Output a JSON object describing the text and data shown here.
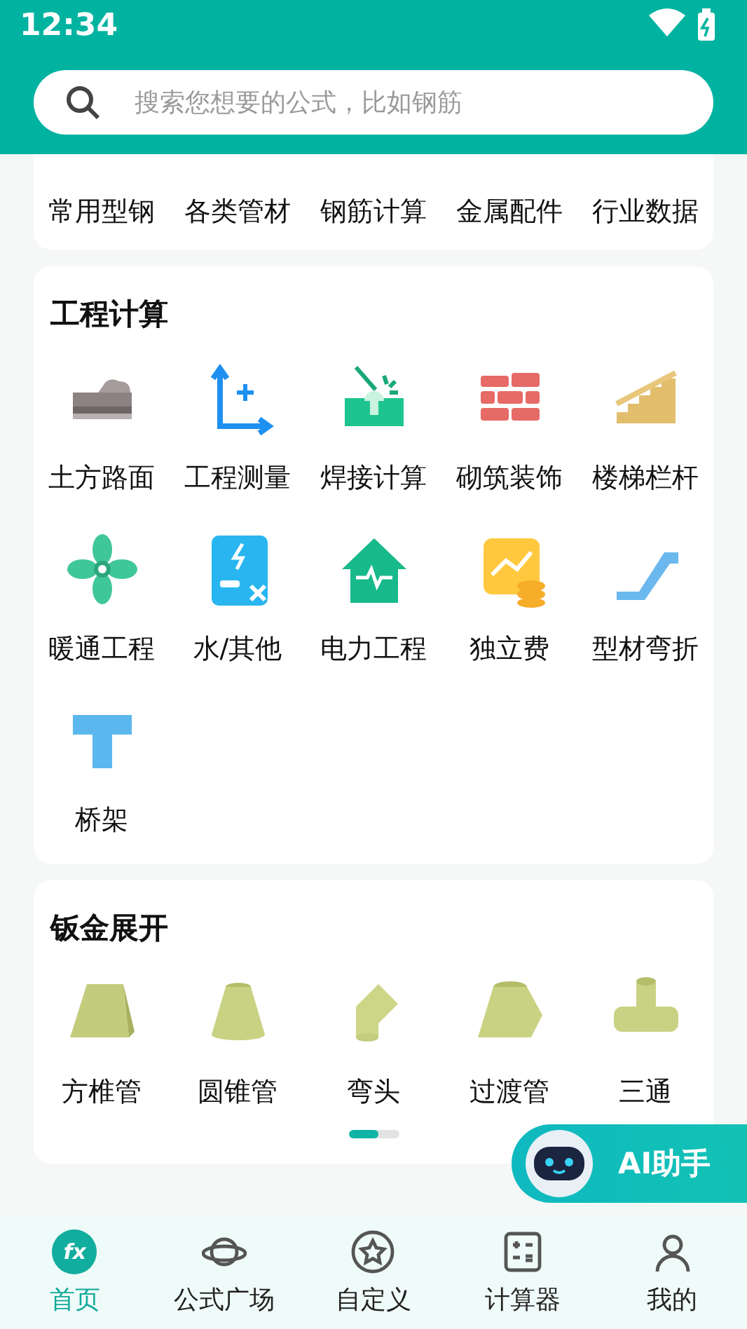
{
  "status_bar": {
    "time": "12:34"
  },
  "search": {
    "placeholder": "搜索您想要的公式，比如钢筋"
  },
  "sections": [
    {
      "items": [
        "常用型钢",
        "各类管材",
        "钢筋计算",
        "金属配件",
        "行业数据"
      ]
    },
    {
      "title": "工程计算",
      "items": [
        "土方路面",
        "工程测量",
        "焊接计算",
        "砌筑装饰",
        "楼梯栏杆",
        "暖通工程",
        "水/其他",
        "电力工程",
        "独立费",
        "型材弯折",
        "桥架"
      ]
    },
    {
      "title": "钣金展开",
      "items": [
        "方椎管",
        "圆锥管",
        "弯头",
        "过渡管",
        "三通"
      ],
      "pager": {
        "level": 0.6
      }
    }
  ],
  "ai_button": {
    "label": "AI助手"
  },
  "tabs": [
    {
      "label": "首页",
      "selected": true,
      "icon_text": "fx"
    },
    {
      "label": "公式广场",
      "selected": false
    },
    {
      "label": "自定义",
      "selected": false
    },
    {
      "label": "计算器",
      "selected": false
    },
    {
      "label": "我的",
      "selected": false
    }
  ]
}
